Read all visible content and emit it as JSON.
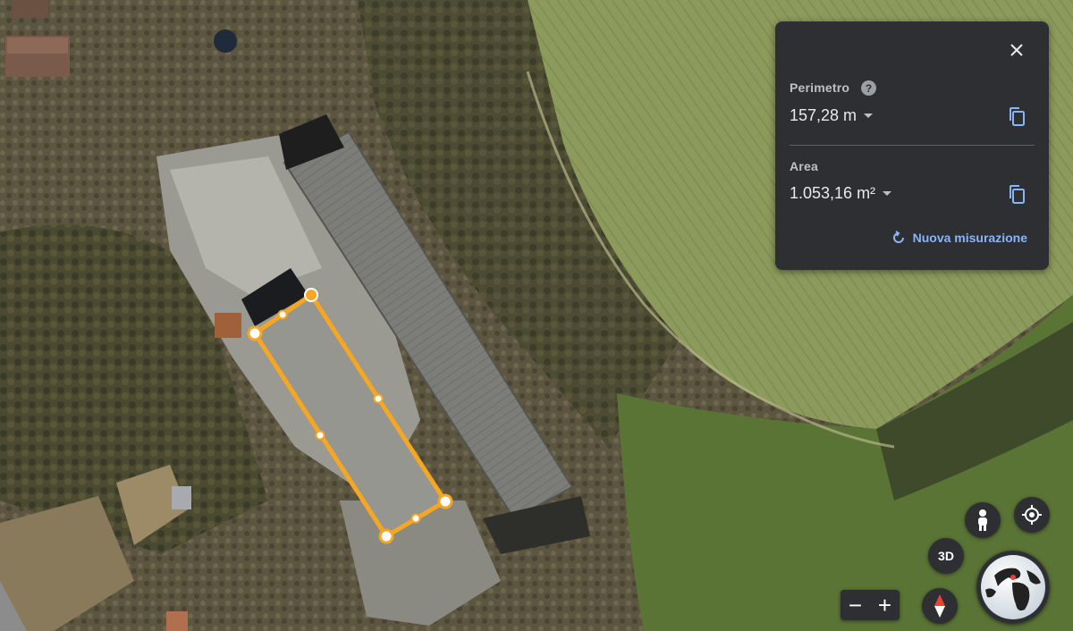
{
  "panel": {
    "perimeter_label": "Perimetro",
    "perimeter_value": "157,28 m",
    "area_label": "Area",
    "area_value": "1.053,16 m²",
    "new_measure_label": "Nuova misurazione",
    "help_glyph": "?"
  },
  "controls": {
    "btn_3d_label": "3D",
    "zoom_out_label": "−",
    "zoom_in_label": "+"
  },
  "icons": {
    "close": "close-icon",
    "help": "help-icon",
    "copy": "copy-icon",
    "refresh": "refresh-icon",
    "pegman": "pegman-icon",
    "my_location": "my-location-icon",
    "compass": "compass-icon",
    "globe": "globe-icon"
  },
  "colors": {
    "measure_outline": "#f5a623",
    "panel_bg": "#2d2f32",
    "accent": "#8ab4f8"
  }
}
